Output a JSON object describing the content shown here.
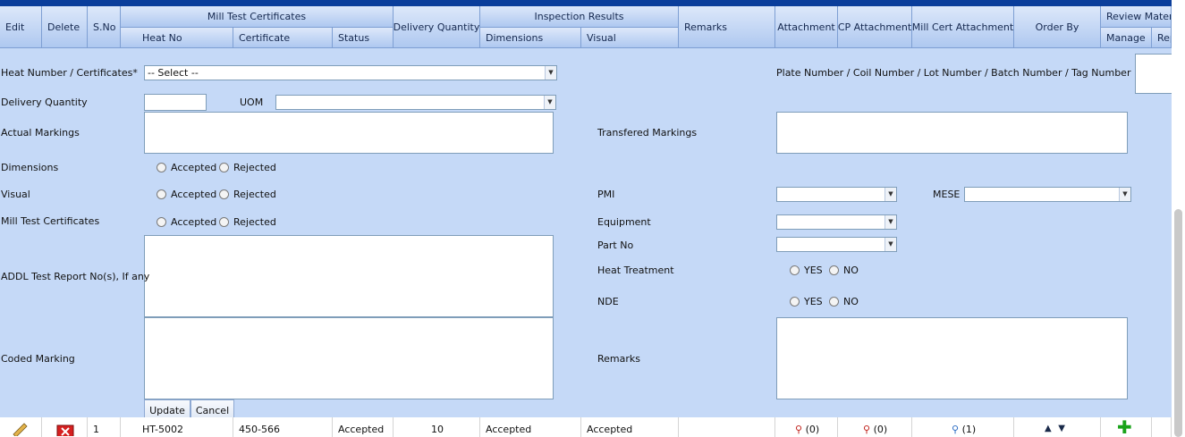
{
  "grid": {
    "headers": {
      "edit": "Edit",
      "delete": "Delete",
      "sno": "S.No",
      "mill_test_certificates": "Mill Test Certificates",
      "heat_no": "Heat No",
      "certificate": "Certificate",
      "status": "Status",
      "delivery_quantity": "Delivery Quantity",
      "inspection_results": "Inspection Results",
      "dimensions": "Dimensions",
      "visual": "Visual",
      "remarks": "Remarks",
      "attachment": "Attachment",
      "cp_attachment": "CP Attachment",
      "mill_cert_attachment": "Mill Cert Attachment",
      "order_by": "Order By",
      "review_material": "Review Materia",
      "manage": "Manage",
      "rep": "Rep"
    },
    "row": {
      "sno": "1",
      "heat_no": "HT-5002",
      "certificate": "450-566",
      "status": "Accepted",
      "delivery_quantity": "10",
      "dimensions": "Accepted",
      "visual": "Accepted",
      "attachment_count": "(0)",
      "cp_attachment_count": "(0)",
      "mill_cert_count": "(1)"
    }
  },
  "form": {
    "heat_number_label": "Heat Number / Certificates*",
    "heat_number_value": "--  Select  --",
    "plate_number_label": "Plate Number / Coil Number / Lot Number / Batch Number / Tag Number",
    "delivery_quantity_label": "Delivery Quantity",
    "uom_label": "UOM",
    "actual_markings_label": "Actual Markings",
    "transfered_markings_label": "Transfered Markings",
    "dimensions_label": "Dimensions",
    "visual_label": "Visual",
    "mill_test_label": "Mill Test Certificates",
    "accepted": "Accepted",
    "rejected": "Rejected",
    "pmi_label": "PMI",
    "mese_label": "MESE",
    "equipment_label": "Equipment",
    "part_no_label": "Part No",
    "heat_treatment_label": "Heat Treatment",
    "nde_label": "NDE",
    "yes": "YES",
    "no": "NO",
    "addl_test_label": "ADDL Test Report No(s), If any",
    "coded_marking_label": "Coded Marking",
    "remarks_label": "Remarks",
    "update_button": "Update",
    "cancel_button": "Cancel"
  },
  "colors": {
    "header_gradient_top": "#dde8fa",
    "header_gradient_bottom": "#aec8f0",
    "form_background": "#c5d9f7",
    "top_bar": "#0b3e9b"
  }
}
